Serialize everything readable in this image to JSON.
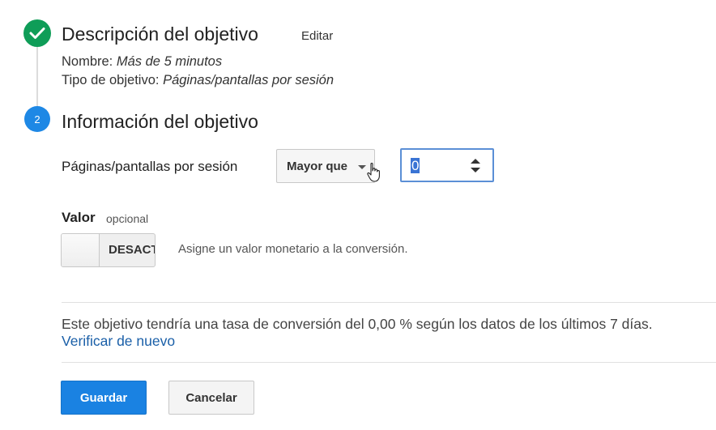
{
  "steps": {
    "description": {
      "number": "",
      "title": "Descripción del objetivo",
      "edit_label": "Editar",
      "name_label": "Nombre:",
      "name_value": "Más de 5 minutos",
      "type_label": "Tipo de objetivo:",
      "type_value": "Páginas/pantallas por sesión"
    },
    "info": {
      "number": "2",
      "title": "Información del objetivo"
    }
  },
  "condition": {
    "label": "Páginas/pantallas por sesión",
    "operator": "Mayor que",
    "value": "0"
  },
  "valor": {
    "label": "Valor",
    "optional": "opcional",
    "toggle_state": "DESACT",
    "description": "Asigne un valor monetario a la conversión."
  },
  "verification": {
    "text": "Este objetivo tendría una tasa de conversión del 0,00 % según los datos de los últimos 7 días.",
    "link": "Verificar de nuevo"
  },
  "actions": {
    "save": "Guardar",
    "cancel": "Cancelar"
  },
  "icons": {
    "step_done": "check-icon",
    "dropdown": "caret-down-icon",
    "cursor": "hand-pointer-icon",
    "spinner": "spinner-arrows-icon"
  },
  "colors": {
    "step_done": "#0f9d58",
    "step_active": "#1e88e5",
    "primary_button": "#1a82e2",
    "link": "#1a5fa8",
    "input_focus": "#5b8fd6"
  }
}
